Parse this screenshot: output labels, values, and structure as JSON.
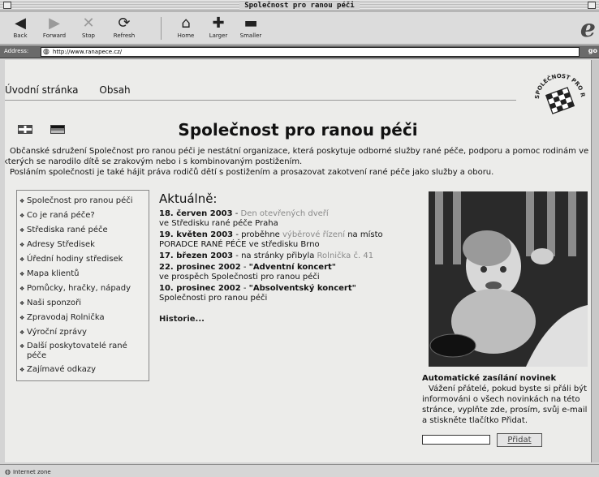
{
  "window": {
    "title": "Společnost pro ranou péči"
  },
  "toolbar": {
    "back": "Back",
    "forward": "Forward",
    "stop": "Stop",
    "refresh": "Refresh",
    "home": "Home",
    "larger": "Larger",
    "smaller": "Smaller",
    "icons": {
      "back": "back-arrow-icon",
      "forward": "forward-arrow-icon",
      "stop": "stop-icon",
      "refresh": "refresh-icon",
      "home": "home-icon",
      "larger": "plus-icon",
      "smaller": "minus-icon",
      "brand": "ie-logo-icon"
    }
  },
  "address": {
    "label": "Address:",
    "url": "http://www.ranapece.cz/",
    "go": "go"
  },
  "nav": {
    "home": "Úvodní stránka",
    "contents": "Obsah"
  },
  "logo": {
    "text": "SPOLEČNOST PRO RANOU PÉČI"
  },
  "page": {
    "title": "Společnost pro ranou péči",
    "intro_1": "Občanské sdružení Společnost pro ranou péči je nestátní organizace, která poskytuje odborné služby rané péče, podporu a pomoc rodinám ve kterých se narodilo dítě se zrakovým nebo i s kombinovaným postižením.",
    "intro_2": "Posláním společnosti je také hájit práva rodičů dětí s postižením a prosazovat zakotvení rané péče jako služby a oboru."
  },
  "sidebar": {
    "items": [
      "Společnost pro ranou péči",
      "Co je raná péče?",
      "Střediska rané péče",
      "Adresy Středisek",
      "Úřední hodiny středisek",
      "Mapa klientů",
      "Pomůcky, hračky, nápady",
      "Naši sponzoři",
      "Zpravodaj Rolnička",
      "Výroční zprávy",
      "Další poskytovatelé rané péče",
      "Zajímavé odkazy"
    ],
    "bullet": "❖"
  },
  "news": {
    "heading": "Aktuálně:",
    "entries": [
      {
        "date": "18. červen 2003",
        "sep": " - ",
        "link": "Den otevřených dveří",
        "rest": "ve Středisku rané péče Praha"
      },
      {
        "date": "19. květen 2003",
        "sep": " - proběhne ",
        "link": "výběrové řízení",
        "rest": " na místo PORADCE RANÉ PÉČE ve středisku Brno"
      },
      {
        "date": "17. březen 2003",
        "sep": " - na stránky přibyla ",
        "link": "Rolnička č. 41",
        "rest": ""
      },
      {
        "date": "22. prosinec 2002",
        "sep": " - ",
        "link": "\"Adventní koncert\"",
        "rest": "ve prospěch Společnosti pro ranou péči"
      },
      {
        "date": "10. prosinec 2002",
        "sep": " - ",
        "link": "\"Absolventský koncert\"",
        "rest": "Společnosti pro ranou péči"
      }
    ],
    "history": "Historie..."
  },
  "newsletter": {
    "title": "Automatické zasílání novinek",
    "text": "Vážení přátelé, pokud byste si přáli být informováni o všech novinkách na této stránce, vyplňte zde, prosím, svůj e-mail a stiskněte tlačítko Přidat.",
    "input_value": "",
    "button": "Přidat"
  },
  "status": {
    "zone": "Internet zone"
  },
  "colors": {
    "content_bg": "#ececea",
    "link_grey": "#8a8a8a",
    "addressbar_bg": "#6a6a6a"
  }
}
